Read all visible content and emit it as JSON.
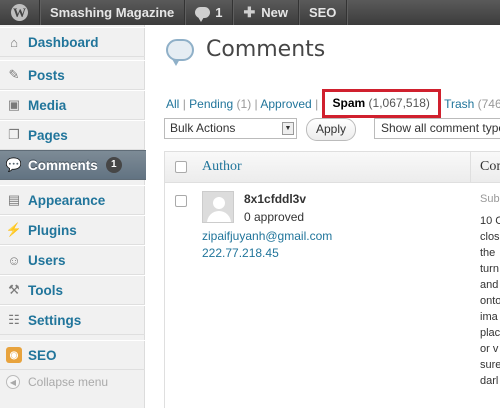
{
  "adminbar": {
    "site_name": "Smashing Magazine",
    "comment_count": "1",
    "new_label": "New",
    "seo_label": "SEO"
  },
  "sidebar": {
    "items": [
      {
        "label": "Dashboard",
        "icon": "dashboard-icon"
      },
      {
        "label": "Posts",
        "icon": "posts-icon"
      },
      {
        "label": "Media",
        "icon": "media-icon"
      },
      {
        "label": "Pages",
        "icon": "pages-icon"
      },
      {
        "label": "Comments",
        "icon": "comments-icon",
        "badge": "1",
        "current": true
      },
      {
        "label": "Appearance",
        "icon": "appearance-icon"
      },
      {
        "label": "Plugins",
        "icon": "plugins-icon"
      },
      {
        "label": "Users",
        "icon": "users-icon"
      },
      {
        "label": "Tools",
        "icon": "tools-icon"
      },
      {
        "label": "Settings",
        "icon": "settings-icon"
      },
      {
        "label": "SEO",
        "icon": "seo-icon"
      }
    ],
    "collapse_label": "Collapse menu"
  },
  "main": {
    "title": "Comments",
    "filters": {
      "all": "All",
      "pending": "Pending",
      "pending_count": "(1)",
      "approved": "Approved",
      "spam": "Spam",
      "spam_count": "(1,067,518)",
      "trash": "Trash",
      "trash_count": "(746"
    },
    "bulk_actions": "Bulk Actions",
    "apply": "Apply",
    "filter_select": "Show all comment type",
    "columns": {
      "author": "Author",
      "comment": "Com"
    },
    "comment": {
      "author_name": "8x1cfddl3v",
      "approved": "0 approved",
      "email": "zipaifjuyanh@gmail.com",
      "ip": "222.77.218.45",
      "submitted": "Sub",
      "lines": [
        "10 C",
        "clos",
        "the",
        "turn",
        "and",
        "onto",
        "ima",
        "plac",
        "or v",
        "sure",
        "darl"
      ]
    }
  },
  "colors": {
    "adminbar": "#464646",
    "link": "#21759b",
    "highlight_box": "#d0202e",
    "current_menu": "#6d7e8c"
  }
}
